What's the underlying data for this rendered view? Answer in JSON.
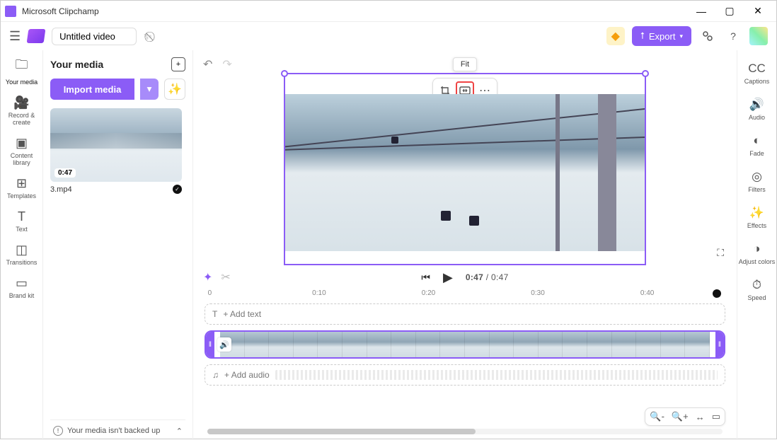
{
  "titlebar": {
    "title": "Microsoft Clipchamp"
  },
  "toolbar": {
    "video_title": "Untitled video",
    "export_label": "Export"
  },
  "leftRail": {
    "items": [
      {
        "label": "Your media"
      },
      {
        "label": "Record & create"
      },
      {
        "label": "Content library"
      },
      {
        "label": "Templates"
      },
      {
        "label": "Text"
      },
      {
        "label": "Transitions"
      },
      {
        "label": "Brand kit"
      }
    ]
  },
  "mediaPanel": {
    "heading": "Your media",
    "import_label": "Import media",
    "clip": {
      "name": "3.mp4",
      "duration": "0:47"
    },
    "backup_msg": "Your media isn't backed up"
  },
  "canvas": {
    "tooltip": "Fit"
  },
  "playback": {
    "current": "0:47",
    "total": "0:47"
  },
  "ruler": {
    "marks": [
      "0",
      "0:10",
      "0:20",
      "0:30",
      "0:40"
    ]
  },
  "tracks": {
    "text_label": "Add text",
    "audio_label": "Add audio"
  },
  "rightRail": {
    "items": [
      {
        "label": "Captions"
      },
      {
        "label": "Audio"
      },
      {
        "label": "Fade"
      },
      {
        "label": "Filters"
      },
      {
        "label": "Effects"
      },
      {
        "label": "Adjust colors"
      },
      {
        "label": "Speed"
      }
    ]
  }
}
